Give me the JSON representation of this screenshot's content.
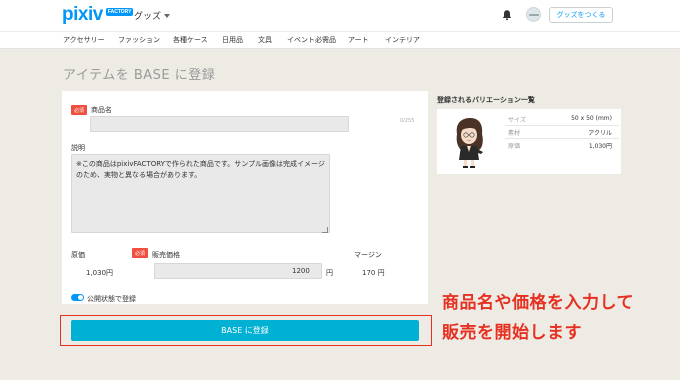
{
  "header": {
    "logo_text": "pixiv",
    "logo_badge": "FACTORY",
    "goods_menu_label": "グッズ",
    "make_goods_label": "グッズをつくる"
  },
  "categories": [
    "アクセサリー",
    "ファッション",
    "各種ケース",
    "日用品",
    "文具",
    "イベント必需品",
    "アート",
    "インテリア"
  ],
  "page_title": "アイテムを BASE に登録",
  "form": {
    "required_label": "必須",
    "product_name_label": "商品名",
    "product_name_value": "",
    "product_name_counter": "0/255",
    "description_label": "説明",
    "description_value": "※この商品はpixivFACTORYで作られた商品です。サンプル画像は完成イメージのため、実物と異なる場合があります。",
    "cost_label": "原価",
    "cost_value": "1,030円",
    "sale_price_label": "販売価格",
    "sale_price_value": "1200",
    "sale_price_unit": "円",
    "margin_label": "マージン",
    "margin_value": "170 円",
    "publish_toggle_label": "公開状態で登録",
    "publish_toggle_on": true,
    "submit_label": "BASE に登録"
  },
  "variation": {
    "title": "登録されるバリエーション一覧",
    "specs": [
      {
        "key": "サイズ",
        "value": "50 x 50 (mm)"
      },
      {
        "key": "素材",
        "value": "アクリル"
      },
      {
        "key": "原価",
        "value": "1,030円"
      }
    ]
  },
  "annotation": {
    "line1": "商品名や価格を入力して",
    "line2": "販売を開始します"
  },
  "colors": {
    "accent_blue": "#0096fa",
    "submit_cyan": "#00b1d4",
    "required_red": "#f04e3e",
    "annotation_red": "#e63122"
  }
}
